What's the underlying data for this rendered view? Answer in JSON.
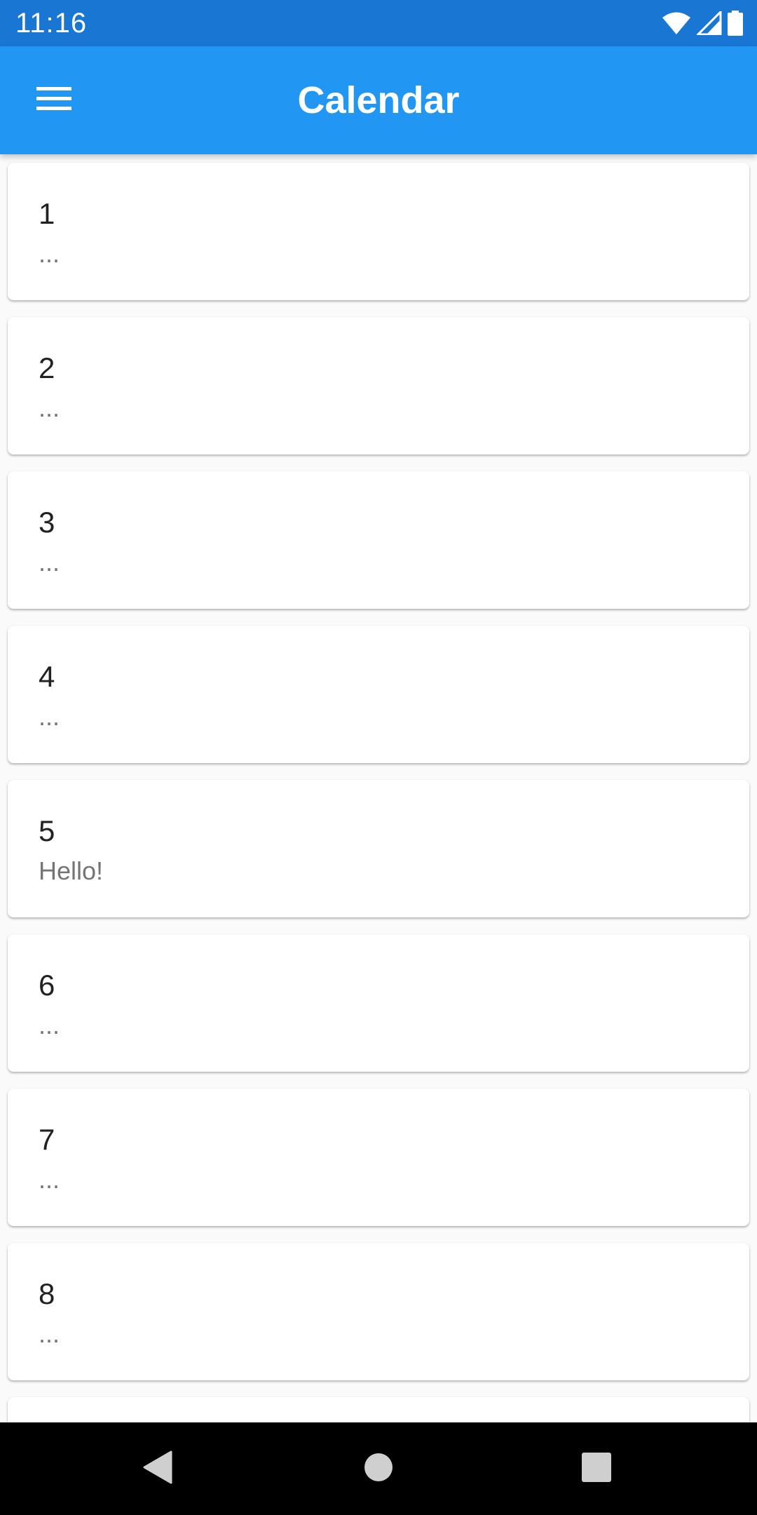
{
  "status_bar": {
    "time": "11:16",
    "icons": [
      "wifi-icon",
      "signal-icon",
      "battery-icon"
    ]
  },
  "app_bar": {
    "title": "Calendar",
    "menu_icon": "hamburger-menu-icon",
    "color": "#2196f3"
  },
  "list": {
    "items": [
      {
        "title": "1",
        "subtitle": "..."
      },
      {
        "title": "2",
        "subtitle": "..."
      },
      {
        "title": "3",
        "subtitle": "..."
      },
      {
        "title": "4",
        "subtitle": "..."
      },
      {
        "title": "5",
        "subtitle": "Hello!"
      },
      {
        "title": "6",
        "subtitle": "..."
      },
      {
        "title": "7",
        "subtitle": "..."
      },
      {
        "title": "8",
        "subtitle": "..."
      }
    ]
  },
  "nav_bar": {
    "icons": [
      "back-icon",
      "home-icon",
      "recents-icon"
    ]
  }
}
